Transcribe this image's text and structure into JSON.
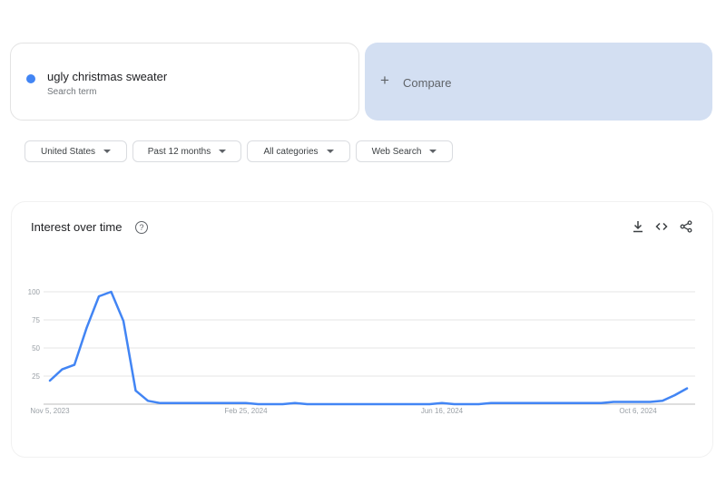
{
  "term": {
    "name": "ugly christmas sweater",
    "subtitle": "Search term",
    "color": "#4285f4"
  },
  "compare": {
    "label": "Compare",
    "icon": "plus-icon",
    "background": "#d3dff2"
  },
  "filters": [
    {
      "label": "United States",
      "width": 113
    },
    {
      "label": "Past 12 months",
      "width": 120
    },
    {
      "label": "All categories",
      "width": 114
    },
    {
      "label": "Web Search",
      "width": 107
    }
  ],
  "chart_card": {
    "title": "Interest over time",
    "help_icon": "help-circle-icon",
    "tools": [
      "download-icon",
      "embed-code-icon",
      "share-icon"
    ]
  },
  "chart_data": {
    "type": "line",
    "title": "Interest over time",
    "xlabel": "",
    "ylabel": "",
    "ylim": [
      0,
      100
    ],
    "yticks": [
      25,
      50,
      75,
      100
    ],
    "grid": true,
    "x_tick_labels": [
      {
        "label": "Nov 5, 2023",
        "week": 0
      },
      {
        "label": "Feb 25, 2024",
        "week": 16
      },
      {
        "label": "Jun 16, 2024",
        "week": 32
      },
      {
        "label": "Oct 6, 2024",
        "week": 48
      }
    ],
    "series": [
      {
        "name": "ugly christmas sweater",
        "color": "#4285f4",
        "values": [
          21,
          31,
          35,
          68,
          96,
          100,
          74,
          12,
          3,
          1,
          1,
          1,
          1,
          1,
          1,
          1,
          1,
          0,
          0,
          0,
          1,
          0,
          0,
          0,
          0,
          0,
          0,
          0,
          0,
          0,
          0,
          0,
          1,
          0,
          0,
          0,
          1,
          1,
          1,
          1,
          1,
          1,
          1,
          1,
          1,
          1,
          2,
          2,
          2,
          2,
          3,
          8,
          14
        ]
      }
    ]
  }
}
